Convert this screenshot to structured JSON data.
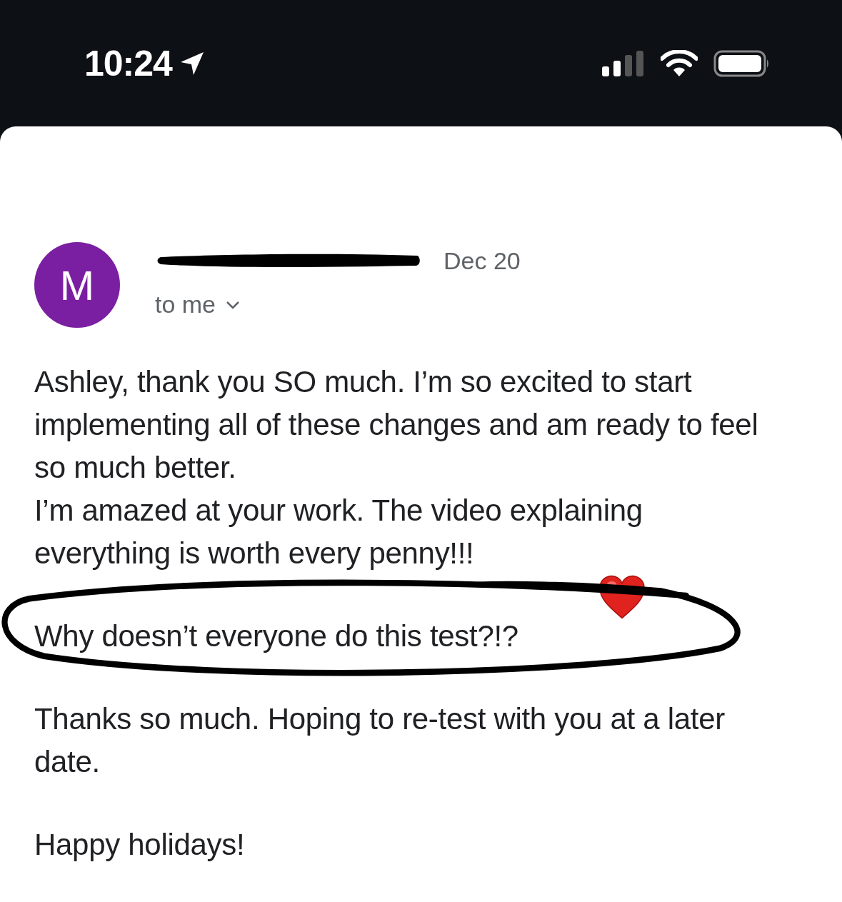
{
  "status_bar": {
    "time": "10:24",
    "location_on": true
  },
  "message": {
    "avatar_letter": "M",
    "sender_redacted": true,
    "date": "Dec 20",
    "recipient": "to me",
    "body": [
      {
        "kind": "text",
        "text": "Ashley, thank you SO much. I’m so excited to start implementing all of these changes and am ready to feel so much better."
      },
      {
        "kind": "text_heart",
        "text": "I’m amazed at your work. The video explaining everything is worth every penny!!!"
      },
      {
        "kind": "circled",
        "text": "Why doesn’t everyone do this test?!?"
      },
      {
        "kind": "text",
        "text": "Thanks so much. Hoping to re-test with you at a later date."
      },
      {
        "kind": "text",
        "text": "Happy holidays!"
      }
    ]
  }
}
